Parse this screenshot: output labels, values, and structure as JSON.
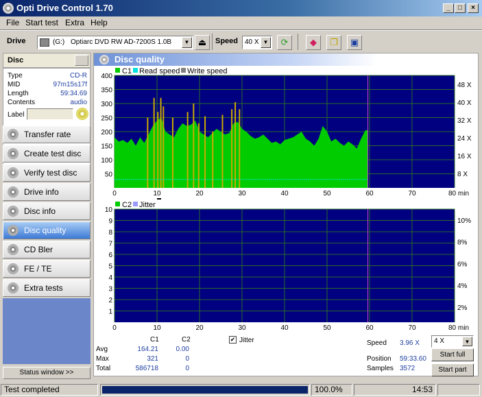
{
  "window": {
    "title": "Opti Drive Control 1.70",
    "min": "_",
    "max": "□",
    "close": "×"
  },
  "menu": [
    "File",
    "Start test",
    "Extra",
    "Help"
  ],
  "toolbar": {
    "drive_label": "Drive",
    "drive_letter": "(G:)",
    "drive_name": "Optiarc DVD RW AD-7200S 1.0B",
    "speed_label": "Speed",
    "speed_value": "40 X"
  },
  "disc": {
    "header": "Disc",
    "type_label": "Type",
    "type_value": "CD-R",
    "mid_label": "MID",
    "mid_value": "97m15s17f",
    "length_label": "Length",
    "length_value": "59:34.69",
    "contents_label": "Contents",
    "contents_value": "audio",
    "label_label": "Label",
    "label_value": ""
  },
  "nav": [
    {
      "label": "Transfer rate",
      "active": false
    },
    {
      "label": "Create test disc",
      "active": false
    },
    {
      "label": "Verify test disc",
      "active": false
    },
    {
      "label": "Drive info",
      "active": false
    },
    {
      "label": "Disc info",
      "active": false
    },
    {
      "label": "Disc quality",
      "active": true
    },
    {
      "label": "CD Bler",
      "active": false
    },
    {
      "label": "FE / TE",
      "active": false
    },
    {
      "label": "Extra tests",
      "active": false
    }
  ],
  "status_window_btn": "Status window >>",
  "panel_title": "Disc quality",
  "colors": {
    "c1": "#00cc00",
    "spike": "#ccaa00",
    "read": "#00e0e0",
    "write": "#808080",
    "plot_bg": "#000080",
    "jitter": "#9a9aff",
    "marker": "#cc44cc"
  },
  "chart_data": [
    {
      "type": "bar",
      "legend": [
        "C1",
        "Read speed",
        "Write speed"
      ],
      "xlim": [
        0,
        80
      ],
      "x_unit": "min",
      "x_ticks": [
        "0",
        "10",
        "20",
        "30",
        "40",
        "50",
        "60",
        "70",
        "80 min"
      ],
      "ylim": [
        0,
        400
      ],
      "y_ticks": [
        "400",
        "350",
        "300",
        "250",
        "200",
        "150",
        "100",
        "50"
      ],
      "y2_ticks": [
        "48 X",
        "40 X",
        "32 X",
        "24 X",
        "16 X",
        "8 X"
      ],
      "data_end": 59.6,
      "c1_x": [
        0,
        1,
        2,
        3,
        4,
        5,
        6,
        7,
        8,
        9,
        10,
        11,
        12,
        13,
        14,
        15,
        16,
        17,
        18,
        19,
        20,
        21,
        22,
        23,
        24,
        25,
        26,
        27,
        28,
        29,
        30,
        31,
        32,
        33,
        34,
        35,
        36,
        37,
        38,
        39,
        40,
        41,
        42,
        43,
        44,
        45,
        46,
        47,
        48,
        49,
        50,
        51,
        52,
        53,
        54,
        55,
        56,
        57,
        58,
        59
      ],
      "c1_y": [
        180,
        165,
        170,
        160,
        175,
        150,
        180,
        160,
        190,
        220,
        240,
        250,
        200,
        190,
        180,
        210,
        230,
        220,
        225,
        240,
        200,
        190,
        180,
        195,
        210,
        200,
        190,
        195,
        230,
        235,
        210,
        200,
        185,
        175,
        180,
        190,
        175,
        160,
        165,
        155,
        170,
        175,
        180,
        190,
        200,
        175,
        165,
        150,
        175,
        220,
        200,
        165,
        175,
        160,
        150,
        165,
        155,
        140,
        175,
        205
      ],
      "spikes": [
        {
          "x": 7.8,
          "y": 250
        },
        {
          "x": 9.3,
          "y": 320
        },
        {
          "x": 10.2,
          "y": 270
        },
        {
          "x": 10.9,
          "y": 320
        },
        {
          "x": 11.5,
          "y": 290
        },
        {
          "x": 13.7,
          "y": 250
        },
        {
          "x": 17.2,
          "y": 270
        },
        {
          "x": 18.6,
          "y": 300
        },
        {
          "x": 19.8,
          "y": 230
        },
        {
          "x": 21.3,
          "y": 255
        },
        {
          "x": 23.1,
          "y": 200
        },
        {
          "x": 25.4,
          "y": 260
        },
        {
          "x": 27.6,
          "y": 280
        },
        {
          "x": 28.4,
          "y": 305
        },
        {
          "x": 29.4,
          "y": 280
        }
      ],
      "read_speed_y": 30
    },
    {
      "type": "line",
      "legend": [
        "C2",
        "Jitter"
      ],
      "xlim": [
        0,
        80
      ],
      "x_ticks": [
        "0",
        "10",
        "20",
        "30",
        "40",
        "50",
        "60",
        "70",
        "80 min"
      ],
      "ylim": [
        0,
        10
      ],
      "y_ticks": [
        "10",
        "9",
        "8",
        "7",
        "6",
        "5",
        "4",
        "3",
        "2",
        "1"
      ],
      "y2_ticks": [
        "10%",
        "8%",
        "6%",
        "4%",
        "2%"
      ],
      "c2_values": [
        0
      ]
    }
  ],
  "stats": {
    "col_c1": "C1",
    "col_c2": "C2",
    "avg_label": "Avg",
    "avg_c1": "164.21",
    "avg_c2": "0.00",
    "max_label": "Max",
    "max_c1": "321",
    "max_c2": "0",
    "total_label": "Total",
    "total_c1": "586718",
    "total_c2": "0",
    "jitter_label": "Jitter",
    "jitter_checked": "✔"
  },
  "right_info": {
    "speed_label": "Speed",
    "speed_value": "3.96 X",
    "speed_select": "4 X",
    "position_label": "Position",
    "position_value": "59:33.60",
    "samples_label": "Samples",
    "samples_value": "3572",
    "start_full": "Start full",
    "start_part": "Start part"
  },
  "statusbar": {
    "status": "Test completed",
    "progress": 100,
    "progress_text": "100.0%",
    "time": "14:53"
  }
}
